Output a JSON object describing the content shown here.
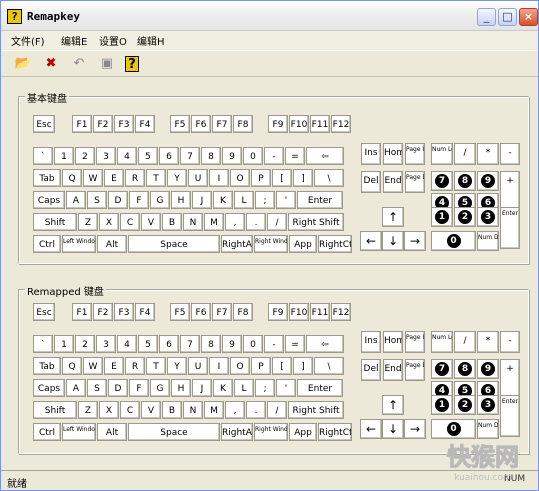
{
  "window": {
    "title": "Remapkey",
    "icon_char": "?"
  },
  "title_buttons": [
    "_",
    "□",
    "×"
  ],
  "menu": [
    "文件(F)",
    "编辑E",
    "设置O",
    "编辑H"
  ],
  "toolbar_icons": [
    "open-icon",
    "delete-icon",
    "reset-icon",
    "view-icon",
    "help-icon"
  ],
  "toolbar_glyphs": [
    "📂",
    "✖",
    "↶",
    "▣",
    "?"
  ],
  "groups": {
    "base_label": "基本键盘",
    "remapped_label": "Remapped 键盘"
  },
  "status": {
    "text": "就绪",
    "right": "NUM"
  },
  "watermark": {
    "big": "快猴网",
    "small": "kuaihou.com"
  },
  "keys": {
    "esc": "Esc",
    "frow": [
      "F1",
      "F2",
      "F3",
      "F4",
      "F5",
      "F6",
      "F7",
      "F8",
      "F9",
      "F10",
      "F11",
      "F12"
    ],
    "num_row": [
      "`",
      "1",
      "2",
      "3",
      "4",
      "5",
      "6",
      "7",
      "8",
      "9",
      "0",
      "-",
      "=",
      "⇦"
    ],
    "tab_row": [
      "Tab",
      "Q",
      "W",
      "E",
      "R",
      "T",
      "Y",
      "U",
      "I",
      "O",
      "P",
      "[",
      "]",
      "\\"
    ],
    "caps_row": [
      "Caps",
      "A",
      "S",
      "D",
      "F",
      "G",
      "H",
      "J",
      "K",
      "L",
      ";",
      "'",
      "Enter"
    ],
    "shift_row": [
      "Shift",
      "Z",
      "X",
      "C",
      "V",
      "B",
      "N",
      "M",
      ",",
      ".",
      "/",
      "Right Shift"
    ],
    "ctrl_row": [
      "Ctrl",
      "Left Windows",
      "Alt",
      "Space",
      "RightAlt",
      "Right Windows",
      "App",
      "RightCtrl"
    ],
    "nav_top": [
      "Ins",
      "Home",
      "Page Up"
    ],
    "nav_bottom": [
      "Del",
      "End",
      "Page Down"
    ],
    "arrows": [
      "↑",
      "←",
      "↓",
      "→"
    ],
    "numpad": {
      "numlock": "Num Lock",
      "slash": "/",
      "star": "*",
      "minus": "-",
      "plus": "+",
      "enter": "Enter",
      "n7": "7",
      "n8": "8",
      "n9": "9",
      "n4": "4",
      "n5": "5",
      "n6": "6",
      "n1": "1",
      "n2": "2",
      "n3": "3",
      "n0": "0",
      "numdel": "Num Del"
    }
  }
}
